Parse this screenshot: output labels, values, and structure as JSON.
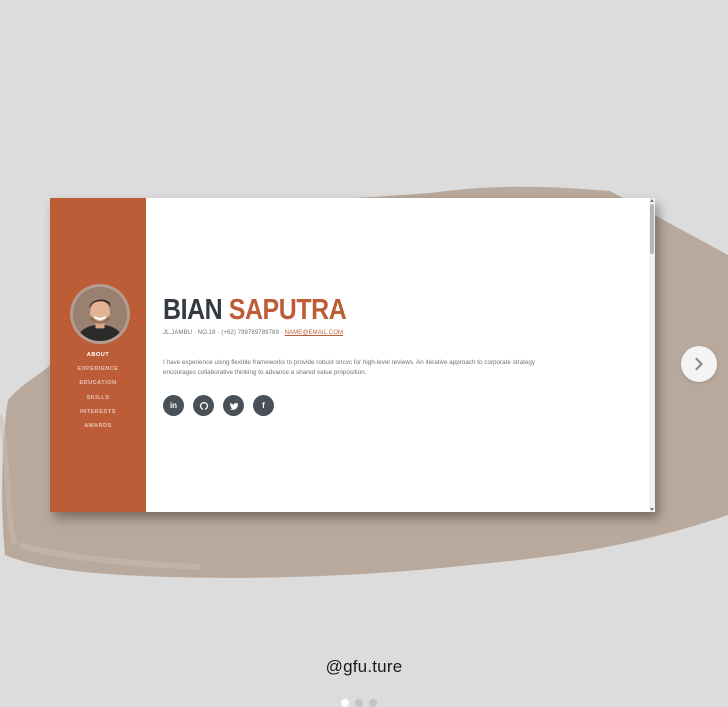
{
  "resume": {
    "name_first": "BIAN",
    "name_last": "SAPUTRA",
    "address": "JL.JAMBU · NO.18 · (+62) 789789789789 · ",
    "email": "NAME@EMAIL.COM",
    "lead": "I have experience using flexible frameworks to provide robust oncvc for high-level reviews. An iterative approach to corporate strategy encourages collaborative thinking to advance a shared value proposition.",
    "nav": [
      {
        "label": "ABOUT"
      },
      {
        "label": "EXPERIENCE"
      },
      {
        "label": "EDUCATION"
      },
      {
        "label": "SKILLS"
      },
      {
        "label": "INTERESTS"
      },
      {
        "label": "AWARDS"
      }
    ],
    "social": [
      {
        "icon": "linkedin-icon",
        "glyph": "in"
      },
      {
        "icon": "github-icon"
      },
      {
        "icon": "twitter-icon"
      },
      {
        "icon": "facebook-icon",
        "glyph": "f"
      }
    ]
  },
  "theme": {
    "accent": "#bd5d38",
    "dark": "#343a40",
    "social_bg": "#495057",
    "background": "#dcdcdc",
    "brush": "#b9a99c"
  },
  "post": {
    "handle": "@gfu.ture",
    "carousel_active_index": 1
  }
}
